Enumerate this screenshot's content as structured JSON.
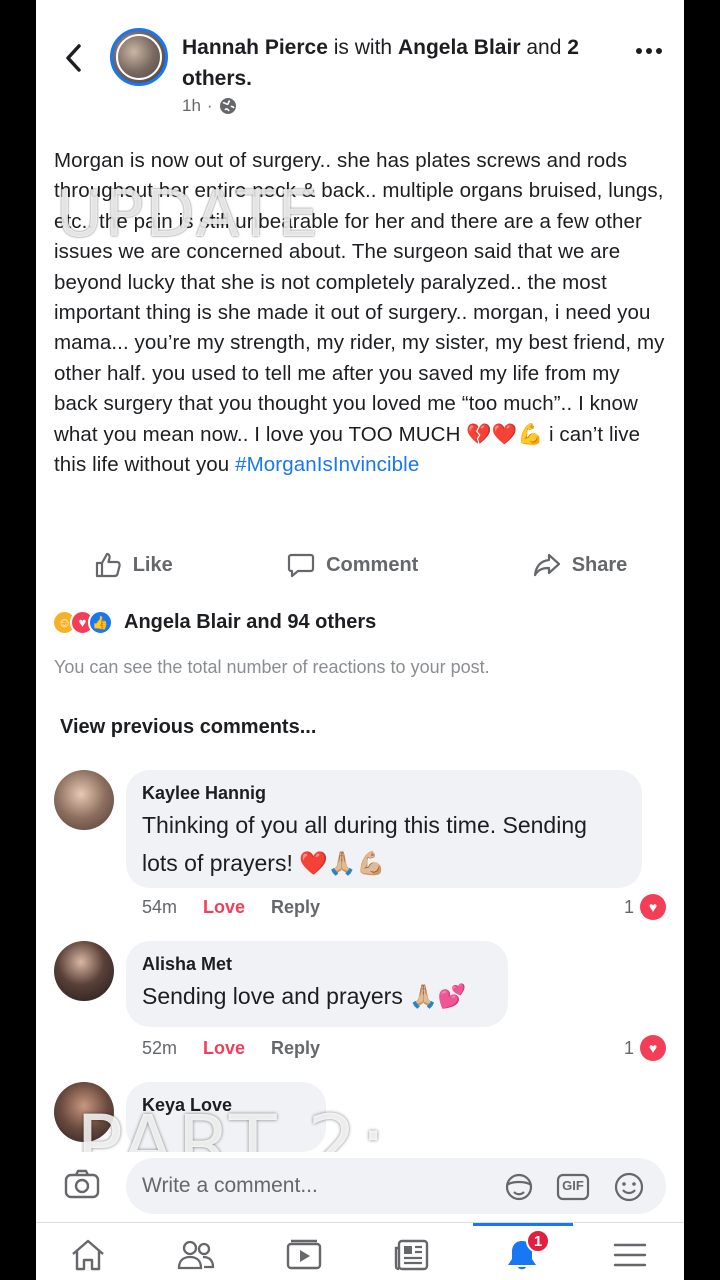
{
  "post": {
    "author": "Hannah Pierce",
    "with_text": "is with",
    "tagged": "Angela Blair",
    "and_text": "and",
    "others": "2 others.",
    "time": "1h",
    "separator": "·",
    "body": "Morgan is now out of surgery.. she has plates screws and rods throughout her entire neck & back.. multiple organs bruised, lungs, etc.. the pain is still unbearable for her and there are a few other issues we are concerned about. The surgeon said that we are beyond lucky that she is not completely paralyzed.. the most important thing is she made it out of surgery.. morgan, i need you mama... you’re my strength, my rider, my sister, my best friend, my other half. you used to tell me after you saved my life from my back surgery that you thought you loved me “too much”.. I know what you mean now.. I love you TOO MUCH 💔❤️💪 i can’t live this life without you ",
    "hashtag": "#MorganIsInvincible",
    "overlay": "UPDATE"
  },
  "actions": {
    "like": "Like",
    "comment": "Comment",
    "share": "Share"
  },
  "reactions": {
    "summary": "Angela Blair and 94 others",
    "note": "You can see the total number of reactions to your post."
  },
  "view_previous": "View previous comments...",
  "comments": [
    {
      "name": "Kaylee Hannig",
      "text": "Thinking of you all during this time. Sending lots of prayers! ❤️🙏🏼💪🏼",
      "time": "54m",
      "love": "Love",
      "reply": "Reply",
      "count": "1"
    },
    {
      "name": "Alisha Met",
      "text": "Sending love and prayers 🙏🏼💕",
      "time": "52m",
      "love": "Love",
      "reply": "Reply",
      "count": "1"
    },
    {
      "name": "Keya Love"
    }
  ],
  "overlay_part": "PART 2:",
  "composer": {
    "placeholder": "Write a comment...",
    "gif": "GIF"
  },
  "nav": {
    "notification_count": "1"
  },
  "colors": {
    "accent": "#1877f2",
    "love": "#f33e58",
    "badge": "#e41e3f"
  }
}
